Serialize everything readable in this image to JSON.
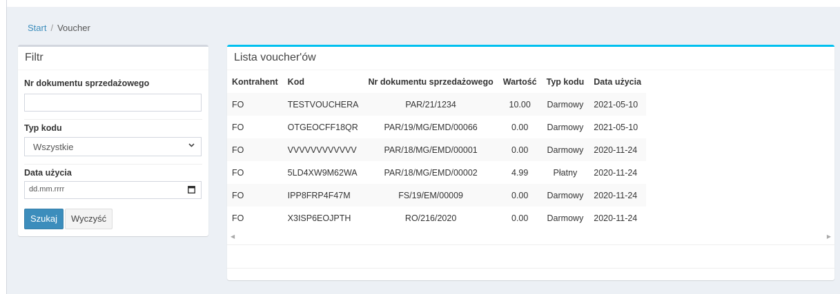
{
  "breadcrumb": {
    "home": "Start",
    "sep": "/",
    "current": "Voucher"
  },
  "filter": {
    "title": "Filtr",
    "doc_label": "Nr dokumentu sprzedażowego",
    "doc_value": "",
    "type_label": "Typ kodu",
    "type_selected": "Wszystkie",
    "date_label": "Data użycia",
    "date_placeholder": "dd.mm.rrrr",
    "search_button": "Szukaj",
    "clear_button": "Wyczyść"
  },
  "list": {
    "title": "Lista voucher'ów",
    "columns": [
      "Kontrahent",
      "Kod",
      "Nr dokumentu sprzedażowego",
      "Wartość",
      "Typ kodu",
      "Data użycia"
    ],
    "rows": [
      [
        "FO",
        "TESTVOUCHERA",
        "PAR/21/1234",
        "10.00",
        "Darmowy",
        "2021-05-10"
      ],
      [
        "FO",
        "OTGEOCFF18QR",
        "PAR/19/MG/EMD/00066",
        "0.00",
        "Darmowy",
        "2021-05-10"
      ],
      [
        "FO",
        "VVVVVVVVVVVV",
        "PAR/18/MG/EMD/00001",
        "0.00",
        "Darmowy",
        "2020-11-24"
      ],
      [
        "FO",
        "5LD4XW9M62WA",
        "PAR/18/MG/EMD/00002",
        "4.99",
        "Płatny",
        "2020-11-24"
      ],
      [
        "FO",
        "IPP8FRP4F47M",
        "FS/19/EM/00009",
        "0.00",
        "Darmowy",
        "2020-11-24"
      ],
      [
        "FO",
        "X3ISP6EOJPTH",
        "RO/216/2020",
        "0.00",
        "Darmowy",
        "2020-11-24"
      ]
    ]
  }
}
